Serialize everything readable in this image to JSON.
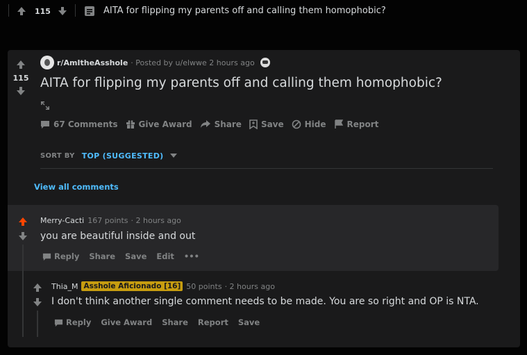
{
  "topbar": {
    "score": "115",
    "title": "AITA for flipping my parents off and calling them homophobic?",
    "icons": [
      "upvote-icon",
      "downvote-icon",
      "post-icon"
    ]
  },
  "post": {
    "subreddit": "r/AmItheAsshole",
    "posted_by": "· Posted by u/elwwe 2 hours ago",
    "score": "115",
    "title": "AITA for flipping my parents off and calling them homophobic?",
    "actions": {
      "comments": "67 Comments",
      "award": "Give Award",
      "share": "Share",
      "save": "Save",
      "hide": "Hide",
      "report": "Report"
    }
  },
  "sort": {
    "label": "SORT BY",
    "value": "TOP (SUGGESTED)"
  },
  "view_all": "View all comments",
  "comments": [
    {
      "author": "Merry-Cacti",
      "points": "167 points",
      "time": "· 2 hours ago",
      "body": "you are beautiful inside and out",
      "actions": {
        "reply": "Reply",
        "share": "Share",
        "save": "Save",
        "edit": "Edit",
        "more": "•••"
      },
      "upvoted": true
    },
    {
      "author": "Thia_M",
      "flair": "Asshole Aficionado [16]",
      "points": "50 points",
      "time": "· 2 hours ago",
      "body": "I don't think another single comment needs to be made. You are so right and OP is NTA.",
      "actions": {
        "reply": "Reply",
        "award": "Give Award",
        "share": "Share",
        "report": "Report",
        "save": "Save"
      }
    }
  ],
  "colors": {
    "background": "#030303",
    "card": "#1a1a1b",
    "highlight": "#272729",
    "link": "#4fbcff",
    "upvote": "#ff4500",
    "flair": "#c79d10"
  }
}
